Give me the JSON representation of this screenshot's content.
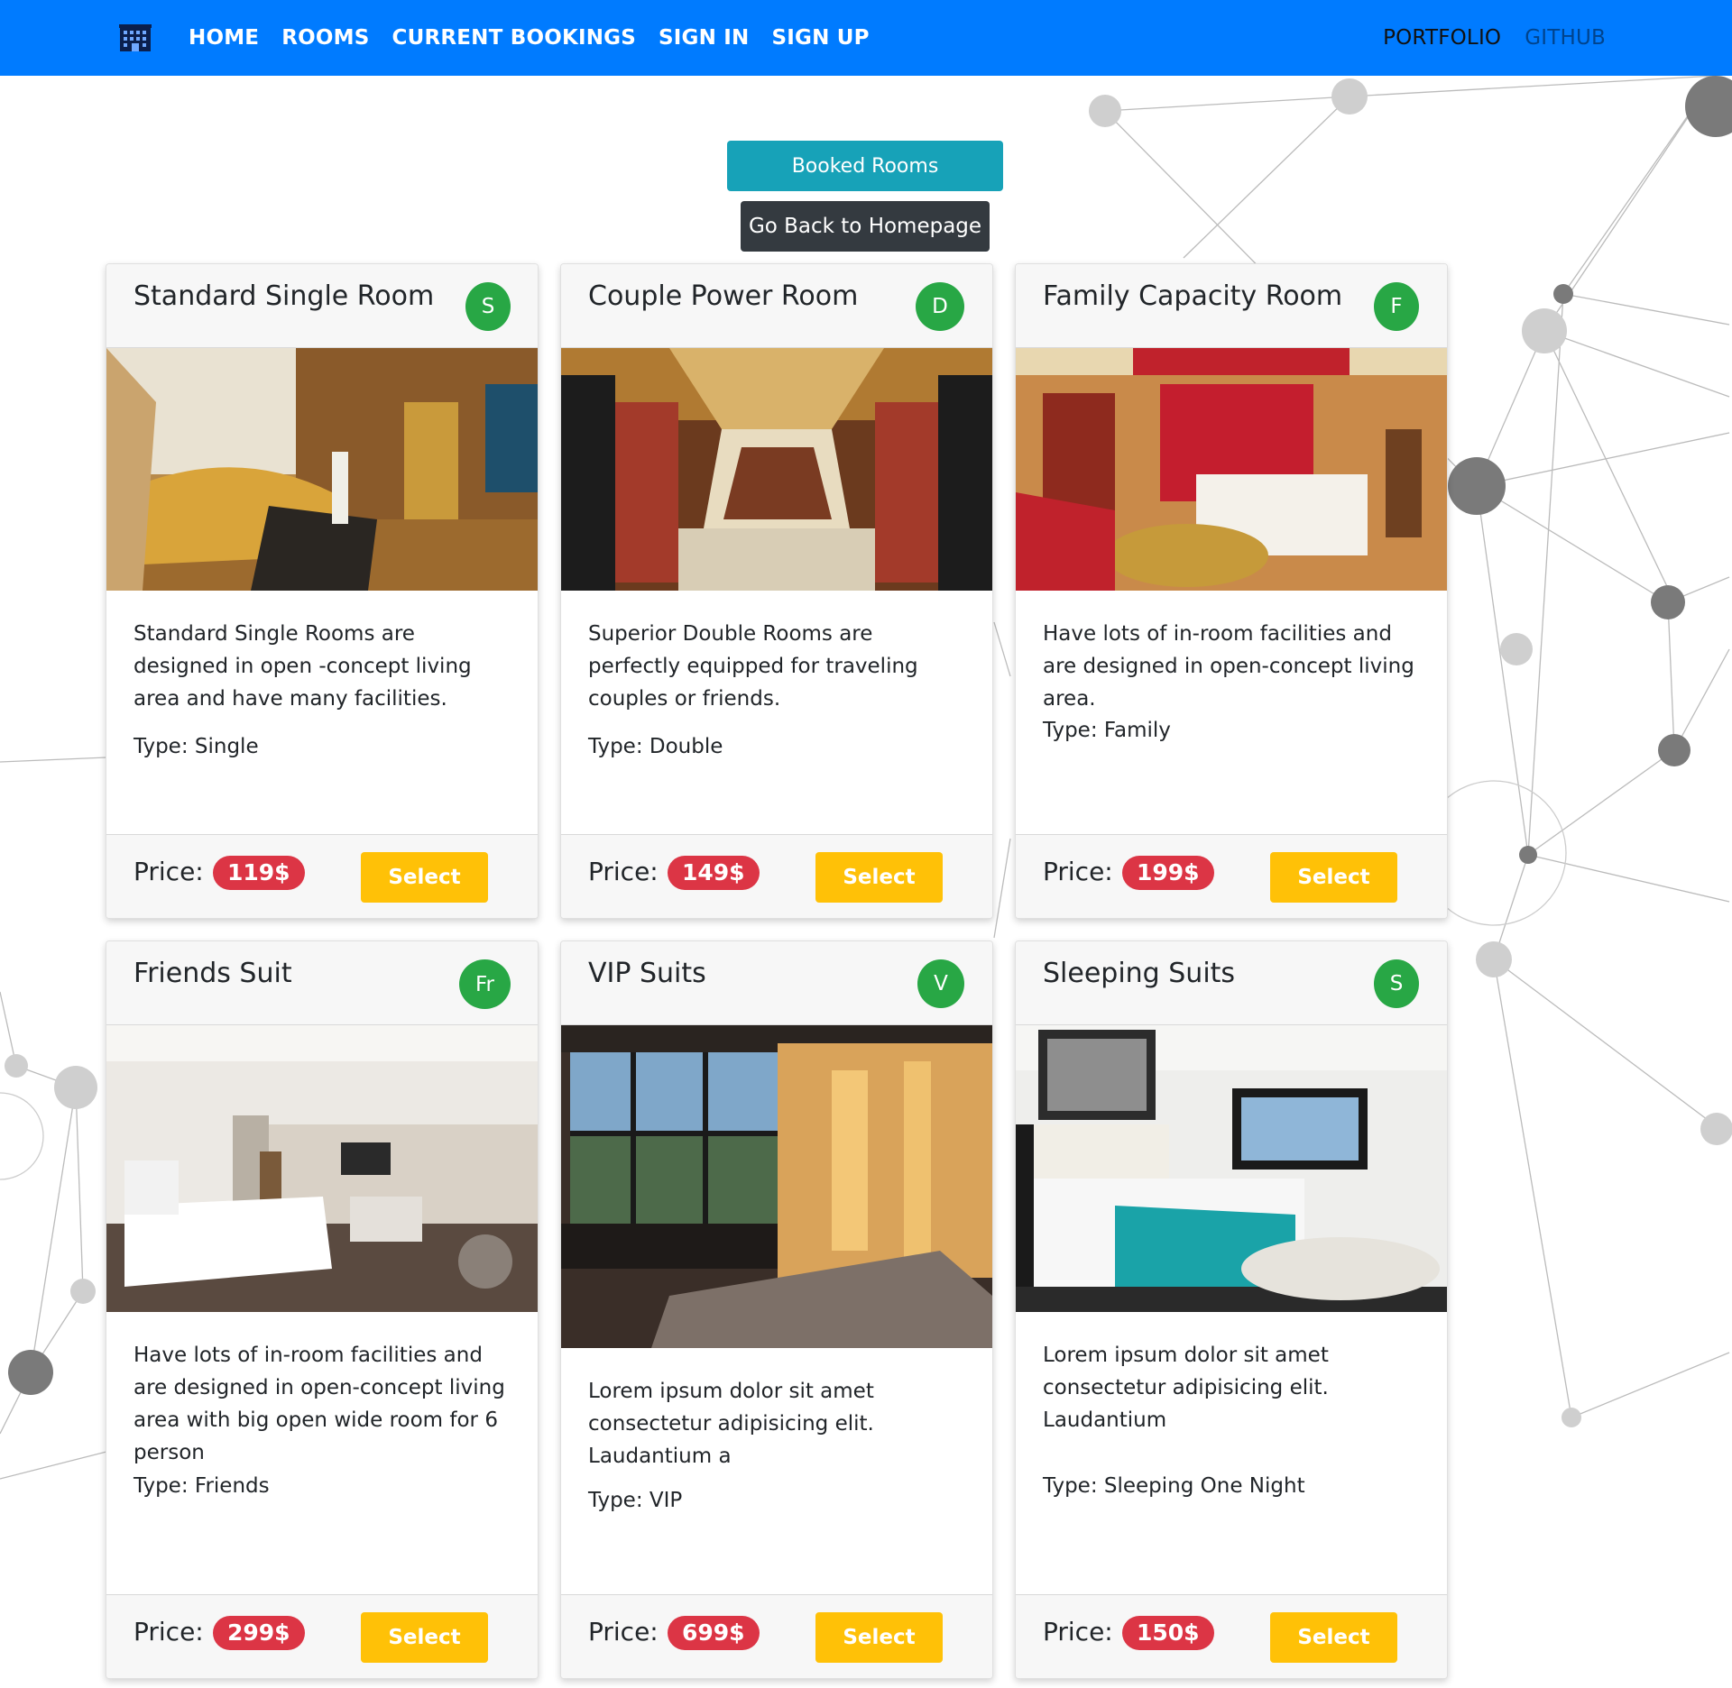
{
  "navbar": {
    "brand_icon": "hotel-building-icon",
    "links": [
      "HOME",
      "ROOMS",
      "CURRENT BOOKINGS",
      "SIGN IN",
      "SIGN UP"
    ],
    "right_links": [
      "PORTFOLIO",
      "GITHUB"
    ]
  },
  "actions": {
    "booked_rooms": "Booked Rooms",
    "go_back": "Go Back to Homepage"
  },
  "colors": {
    "navbar": "#007bff",
    "booked_button": "#17a2b8",
    "homepage_button": "#343a40",
    "avatar": "#28a745",
    "price_badge": "#dc3545",
    "select_button": "#ffc107"
  },
  "rooms": [
    {
      "title": "Standard Single Room",
      "avatar": "S",
      "image": "luxury-lounge-photo",
      "description": "Standard Single Rooms are designed in open -concept living area and have many facilities.",
      "type_label": "Type: Single",
      "price_label": "Price:",
      "price": "119$",
      "select": "Select"
    },
    {
      "title": "Couple Power Room",
      "avatar": "D",
      "image": "grand-staircase-photo",
      "description": "Superior Double Rooms are perfectly equipped for traveling couples or friends.",
      "type_label": "Type: Double",
      "price_label": "Price:",
      "price": "149$",
      "select": "Select"
    },
    {
      "title": "Family Capacity Room",
      "avatar": "F",
      "image": "red-suite-bedroom-photo",
      "description": "Have lots of in-room facilities and are designed in open-concept living area.",
      "type_label": "Type: Family",
      "price_label": "Price:",
      "price": "199$",
      "select": "Select"
    },
    {
      "title": "Friends Suit",
      "avatar": "Fr",
      "image": "white-bedroom-photo",
      "description": "Have lots of in-room facilities and are designed in open-concept living area with big open wide room for 6 person",
      "type_label": "Type: Friends",
      "price_label": "Price:",
      "price": "299$",
      "select": "Select"
    },
    {
      "title": "VIP Suits",
      "avatar": "V",
      "image": "city-view-bedroom-photo",
      "description": "Lorem ipsum dolor sit amet consectetur adipisicing elit. Laudantium a",
      "type_label": "Type: VIP",
      "price_label": "Price:",
      "price": "699$",
      "select": "Select"
    },
    {
      "title": "Sleeping Suits",
      "avatar": "S",
      "image": "teal-bedspread-bedroom-photo",
      "description": "Lorem ipsum dolor sit amet consectetur adipisicing elit. Laudantium",
      "type_label": "Type: Sleeping One Night",
      "price_label": "Price:",
      "price": "150$",
      "select": "Select"
    }
  ]
}
